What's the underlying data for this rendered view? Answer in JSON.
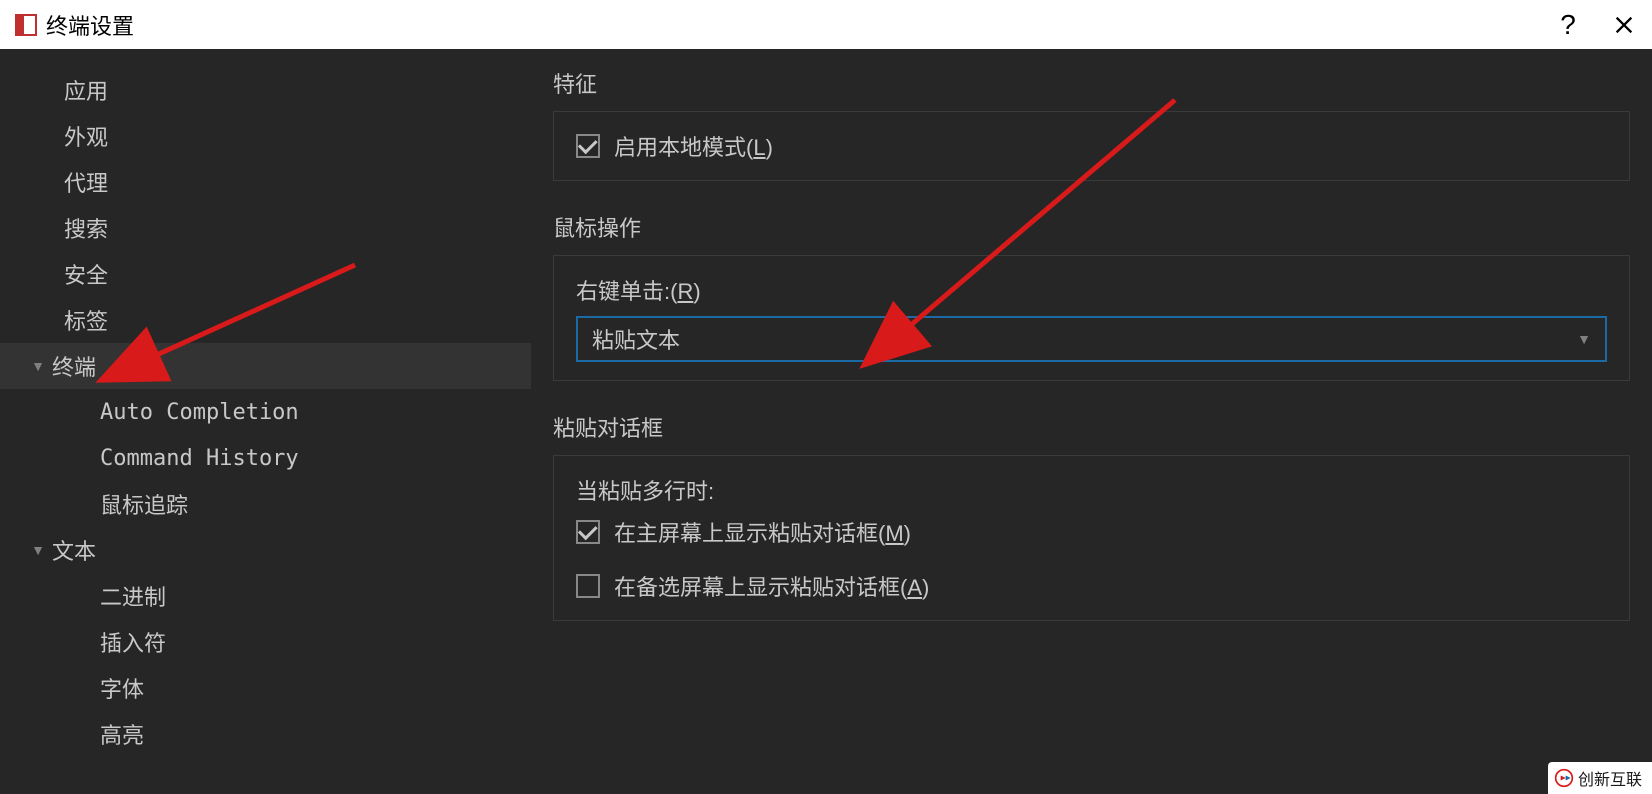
{
  "titlebar": {
    "title": "终端设置",
    "help_label": "?",
    "close_label": "✕"
  },
  "sidebar": {
    "items": [
      {
        "label": "应用"
      },
      {
        "label": "外观"
      },
      {
        "label": "代理"
      },
      {
        "label": "搜索"
      },
      {
        "label": "安全"
      },
      {
        "label": "标签"
      },
      {
        "label": "终端",
        "expanded": true,
        "selected": true
      },
      {
        "label": "Auto Completion",
        "child": true,
        "mono": true
      },
      {
        "label": "Command History",
        "child": true,
        "mono": true
      },
      {
        "label": "鼠标追踪",
        "child": true
      },
      {
        "label": "文本",
        "expanded": true
      },
      {
        "label": "二进制",
        "child": true
      },
      {
        "label": "插入符",
        "child": true
      },
      {
        "label": "字体",
        "child": true
      },
      {
        "label": "高亮",
        "child": true
      }
    ]
  },
  "content": {
    "feature_section": "特征",
    "enable_local_mode_prefix": "启用本地模式(",
    "enable_local_mode_key": "L",
    "enable_local_mode_suffix": ")",
    "mouse_section": "鼠标操作",
    "right_click_prefix": "右键单击:(",
    "right_click_key": "R",
    "right_click_suffix": ")",
    "right_click_value": "粘贴文本",
    "paste_section": "粘贴对话框",
    "paste_multi_label": "当粘贴多行时:",
    "paste_main_prefix": "在主屏幕上显示粘贴对话框(",
    "paste_main_key": "M",
    "paste_main_suffix": ")",
    "paste_alt_prefix": "在备选屏幕上显示粘贴对话框(",
    "paste_alt_key": "A",
    "paste_alt_suffix": ")"
  },
  "watermark": {
    "text": "创新互联"
  }
}
